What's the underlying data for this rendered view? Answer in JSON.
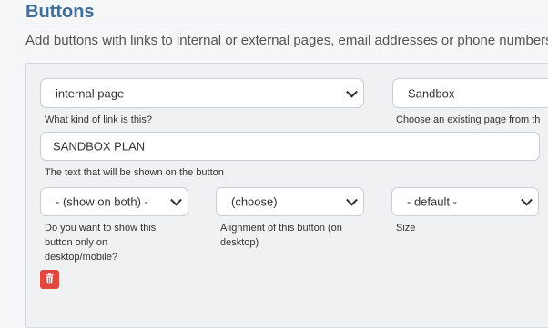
{
  "section": {
    "title": "Buttons",
    "description": "Add buttons with links to internal or external pages, email addresses or phone numbers"
  },
  "fields": {
    "link_type": {
      "value": "internal page",
      "label": "What kind of link is this?"
    },
    "page": {
      "value": "Sandbox",
      "label": "Choose an existing page from th"
    },
    "button_text": {
      "value": "SANDBOX PLAN",
      "label": "The text that will be shown on the button"
    },
    "show_on": {
      "value": "- (show on both) -",
      "label": "Do you want to show this button only on desktop/mobile?"
    },
    "alignment": {
      "value": "(choose)",
      "label": "Alignment of this button (on desktop)"
    },
    "size": {
      "value": "- default -",
      "label": "Size"
    }
  },
  "icons": {
    "delete": "trash-icon",
    "dropdown": "chevron-down-icon"
  },
  "colors": {
    "accent": "#3f6f9a",
    "danger": "#e0483d"
  }
}
